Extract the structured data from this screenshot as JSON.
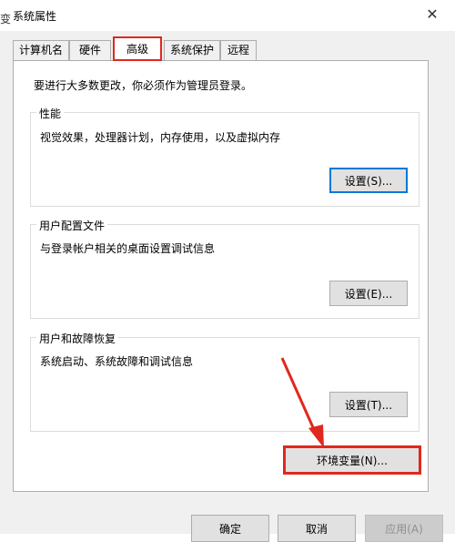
{
  "window": {
    "title": "系统属性",
    "left_edge_fragment": "变",
    "close_icon": "close-icon"
  },
  "tabs": [
    {
      "label": "计算机名",
      "active": false
    },
    {
      "label": "硬件",
      "active": false
    },
    {
      "label": "高级",
      "active": true,
      "highlighted": true
    },
    {
      "label": "系统保护",
      "active": false
    },
    {
      "label": "远程",
      "active": false
    }
  ],
  "notice": "要进行大多数更改，你必须作为管理员登录。",
  "groups": {
    "performance": {
      "label": "性能",
      "description": "视觉效果，处理器计划，内存使用，以及虚拟内存",
      "button": "设置(S)..."
    },
    "user_profiles": {
      "label": "用户配置文件",
      "description": "与登录帐户相关的桌面设置调试信息",
      "button": "设置(E)..."
    },
    "startup_recovery": {
      "label": "用户和故障恢复",
      "description": "系统启动、系统故障和调试信息",
      "button": "设置(T)..."
    }
  },
  "env_button": "环境变量(N)...",
  "footer": {
    "ok": "确定",
    "cancel": "取消",
    "apply": "应用(A)"
  },
  "colors": {
    "highlight_red": "#e0281e",
    "focus_blue": "#0078d7"
  }
}
